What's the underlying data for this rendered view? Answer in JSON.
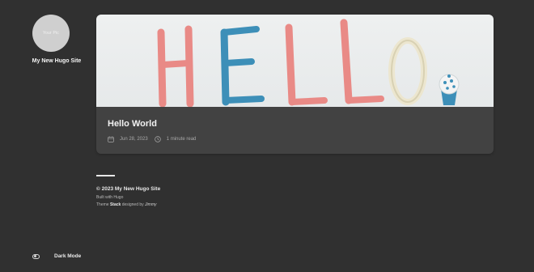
{
  "sidebar": {
    "avatar_text": "Your Pic",
    "site_title": "My New Hugo Site",
    "dark_mode_label": "Dark Mode",
    "dark_mode_icon": "toggle-icon"
  },
  "article": {
    "hero_image_alt": "HELLO",
    "title": "Hello World",
    "date": "Jun 28, 2023",
    "reading_time": "1 minute read",
    "date_icon": "calendar-icon",
    "time_icon": "clock-icon"
  },
  "footer": {
    "copyright": "© 2023 My New Hugo Site",
    "built_with": "Built with Hugo",
    "theme_prefix": "Theme",
    "theme_name": "Stack",
    "theme_middle": "designed by",
    "theme_author": "Jimmy"
  },
  "colors": {
    "background": "#303030",
    "card": "#424242",
    "hero_pink": "#e98a86",
    "hero_blue": "#3d8fb8",
    "hero_cream": "#ece6cf"
  }
}
